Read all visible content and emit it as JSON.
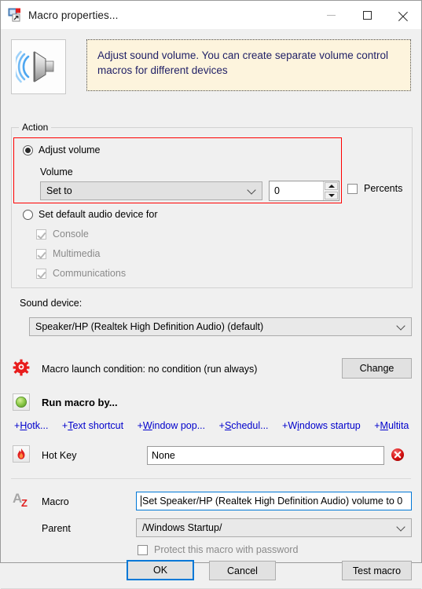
{
  "window": {
    "title": "Macro properties...",
    "icon": "macro-shortcut-icon",
    "controls": {
      "minimize": "minimize-icon",
      "maximize": "maximize-icon",
      "close": "close-icon"
    }
  },
  "header": {
    "icon": "speaker-volume-icon",
    "description": "Adjust sound volume. You can create separate volume control macros for different devices"
  },
  "action_group": {
    "title": "Action",
    "adjust_volume": {
      "label": "Adjust volume",
      "selected": true,
      "volume_label": "Volume",
      "mode_value": "Set to",
      "amount_value": "0",
      "percents_label": "Percents",
      "percents_checked": false
    },
    "set_default_device": {
      "label": "Set default audio device for",
      "selected": false,
      "options": [
        {
          "label": "Console",
          "checked": true,
          "enabled": false
        },
        {
          "label": "Multimedia",
          "checked": true,
          "enabled": false
        },
        {
          "label": "Communications",
          "checked": true,
          "enabled": false
        }
      ]
    }
  },
  "sound_device": {
    "label": "Sound device:",
    "value": "Speaker/HP (Realtek High Definition Audio) (default)"
  },
  "launch_condition": {
    "icon": "red-gear-icon",
    "text": "Macro launch condition: no condition (run always)",
    "button": "Change"
  },
  "run_macro_by": {
    "icon": "green-button-icon",
    "title": "Run macro by...",
    "links": [
      {
        "prefix": "+",
        "accel": "H",
        "rest": "otk..."
      },
      {
        "prefix": "+",
        "accel": "T",
        "rest": "ext shortcut"
      },
      {
        "prefix": "+",
        "accel": "W",
        "rest": "indow pop..."
      },
      {
        "prefix": "+",
        "accel": "S",
        "rest": "chedul..."
      },
      {
        "prefix": "+",
        "accel": "W",
        "rest": "indows startup",
        "pre": ""
      },
      {
        "prefix": "+",
        "accel": "M",
        "rest": "ultita"
      }
    ]
  },
  "hotkey": {
    "icon": "flame-icon",
    "label": "Hot Key",
    "value": "None",
    "clear_icon": "red-delete-icon"
  },
  "macro": {
    "icon": "az-sort-icon",
    "label": "Macro",
    "value": "Set Speaker/HP (Realtek High Definition Audio) volume to 0",
    "parent_label": "Parent",
    "parent_value": "/Windows Startup/"
  },
  "footer": {
    "protect_label": "Protect this macro with password",
    "protect_checked": false,
    "ok": "OK",
    "cancel": "Cancel",
    "test": "Test macro"
  },
  "colors": {
    "accent": "#0078d7",
    "highlight_frame": "#ff0000",
    "link": "#0000cc",
    "description_bg": "#fdf4dd"
  }
}
